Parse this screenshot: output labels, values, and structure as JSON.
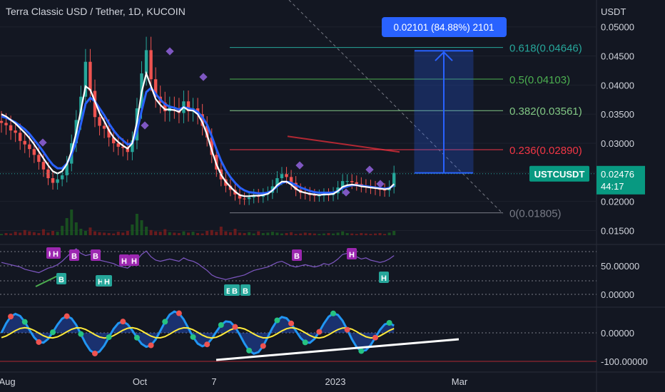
{
  "header": {
    "title": "Terra Classic USD / Tether, 1D, KUCOIN",
    "currency": "USDT"
  },
  "chart_data": [
    {
      "type": "candlestick",
      "symbol": "USTCUSDT",
      "last_price": "0.02476",
      "countdown": "44:17",
      "y_ticks": [
        "0.05000",
        "0.04500",
        "0.04000",
        "0.03500",
        "0.03000",
        "0.02500",
        "0.02000",
        "0.01500"
      ],
      "ylim": [
        0.0142,
        0.0507
      ],
      "x_ticks": [
        "Aug",
        "Oct",
        "7",
        "2023",
        "Mar"
      ],
      "close": [
        0.0335,
        0.0331,
        0.0322,
        0.0318,
        0.0304,
        0.0298,
        0.029,
        0.028,
        0.0268,
        0.0255,
        0.024,
        0.0232,
        0.0238,
        0.0245,
        0.0265,
        0.03,
        0.034,
        0.038,
        0.044,
        0.039,
        0.0345,
        0.033,
        0.0325,
        0.031,
        0.03,
        0.0294,
        0.0292,
        0.0285,
        0.0305,
        0.036,
        0.042,
        0.046,
        0.041,
        0.038,
        0.037,
        0.0355,
        0.0362,
        0.036,
        0.0352,
        0.0372,
        0.0355,
        0.036,
        0.035,
        0.033,
        0.031,
        0.028,
        0.0255,
        0.0238,
        0.0227,
        0.022,
        0.0212,
        0.0205,
        0.0204,
        0.0207,
        0.0211,
        0.0208,
        0.0212,
        0.0215,
        0.0226,
        0.024,
        0.0247,
        0.0242,
        0.0232,
        0.022,
        0.0215,
        0.0214,
        0.0211,
        0.021,
        0.021,
        0.0212,
        0.0211,
        0.0214,
        0.0224,
        0.0235,
        0.0235,
        0.0233,
        0.023,
        0.0227,
        0.0226,
        0.0224,
        0.0222,
        0.022,
        0.0219,
        0.0225,
        0.0249
      ],
      "ema_white": [
        0.035,
        0.0346,
        0.034,
        0.0334,
        0.0326,
        0.0318,
        0.0309,
        0.0298,
        0.0286,
        0.0274,
        0.0262,
        0.0252,
        0.0248,
        0.0252,
        0.0264,
        0.0286,
        0.0318,
        0.0356,
        0.0398,
        0.0392,
        0.0372,
        0.0352,
        0.0338,
        0.0322,
        0.031,
        0.0302,
        0.0296,
        0.0291,
        0.03,
        0.0336,
        0.0388,
        0.042,
        0.0398,
        0.0376,
        0.0366,
        0.0358,
        0.0358,
        0.0357,
        0.0354,
        0.0362,
        0.0357,
        0.0356,
        0.035,
        0.0336,
        0.0315,
        0.0288,
        0.0264,
        0.0246,
        0.0234,
        0.0225,
        0.0217,
        0.0211,
        0.0209,
        0.0209,
        0.021,
        0.021,
        0.0211,
        0.0213,
        0.0219,
        0.0228,
        0.0234,
        0.0234,
        0.0229,
        0.0222,
        0.0217,
        0.0215,
        0.0213,
        0.0212,
        0.0211,
        0.0212,
        0.0212,
        0.0213,
        0.0218,
        0.0225,
        0.0228,
        0.0229,
        0.0228,
        0.0226,
        0.0225,
        0.0224,
        0.0223,
        0.0222,
        0.0221,
        0.0222,
        0.023
      ],
      "ema_blue": [
        0.0346,
        0.0344,
        0.034,
        0.0336,
        0.033,
        0.0324,
        0.0316,
        0.0306,
        0.0296,
        0.0285,
        0.0273,
        0.0263,
        0.0257,
        0.0257,
        0.0265,
        0.028,
        0.0302,
        0.0333,
        0.0368,
        0.0378,
        0.0372,
        0.036,
        0.0348,
        0.0334,
        0.0322,
        0.0312,
        0.0305,
        0.0298,
        0.03,
        0.032,
        0.0356,
        0.0388,
        0.0395,
        0.0385,
        0.0375,
        0.0367,
        0.0363,
        0.0361,
        0.0358,
        0.0362,
        0.036,
        0.0358,
        0.0354,
        0.0345,
        0.0332,
        0.0312,
        0.029,
        0.027,
        0.0254,
        0.0242,
        0.0232,
        0.0224,
        0.0219,
        0.0216,
        0.0215,
        0.0214,
        0.0214,
        0.0215,
        0.0219,
        0.0226,
        0.0232,
        0.0234,
        0.0232,
        0.0228,
        0.0224,
        0.0221,
        0.0218,
        0.0216,
        0.0215,
        0.0215,
        0.0215,
        0.0215,
        0.0218,
        0.0223,
        0.0226,
        0.0228,
        0.0228,
        0.0227,
        0.0226,
        0.0225,
        0.0224,
        0.0223,
        0.0222,
        0.0223,
        0.0228
      ],
      "fib_levels": [
        {
          "label": "0.618(0.04646)",
          "value": 0.04646,
          "color": "#26a69a"
        },
        {
          "label": "0.5(0.04103)",
          "value": 0.04103,
          "color": "#4caf50"
        },
        {
          "label": "0.382(0.03561)",
          "value": 0.03561,
          "color": "#81c784"
        },
        {
          "label": "0.236(0.02890)",
          "value": 0.0289,
          "color": "#f23645"
        },
        {
          "label": "0(0.01805)",
          "value": 0.01805,
          "color": "#787b86"
        }
      ],
      "measure": {
        "label": "0.02101 (84.88%) 2101",
        "from": 0.0249,
        "to": 0.0459
      },
      "resistance_line": {
        "from": 0.0312,
        "to": 0.0285
      }
    },
    {
      "type": "line",
      "name": "oscillator-1",
      "y_ticks": [
        "50.00000",
        "0.00000"
      ],
      "levels": [
        50,
        0
      ],
      "markers": [
        {
          "text": "H",
          "color": "#9c27b0"
        },
        {
          "text": "H",
          "color": "#9c27b0"
        },
        {
          "text": "B",
          "color": "#9c27b0"
        },
        {
          "text": "B",
          "color": "#9c27b0"
        },
        {
          "text": "H",
          "color": "#9c27b0"
        },
        {
          "text": "H",
          "color": "#9c27b0"
        },
        {
          "text": "B",
          "color": "#9c27b0"
        },
        {
          "text": "H",
          "color": "#9c27b0"
        },
        {
          "text": "B",
          "color": "#26a69a"
        },
        {
          "text": "H",
          "color": "#26a69a"
        },
        {
          "text": "H",
          "color": "#26a69a"
        },
        {
          "text": "B",
          "color": "#26a69a"
        },
        {
          "text": "B",
          "color": "#26a69a"
        },
        {
          "text": "B",
          "color": "#26a69a"
        },
        {
          "text": "H",
          "color": "#26a69a"
        }
      ]
    },
    {
      "type": "line",
      "name": "oscillator-2",
      "y_ticks": [
        "0.00000",
        "-100.00000"
      ]
    }
  ]
}
